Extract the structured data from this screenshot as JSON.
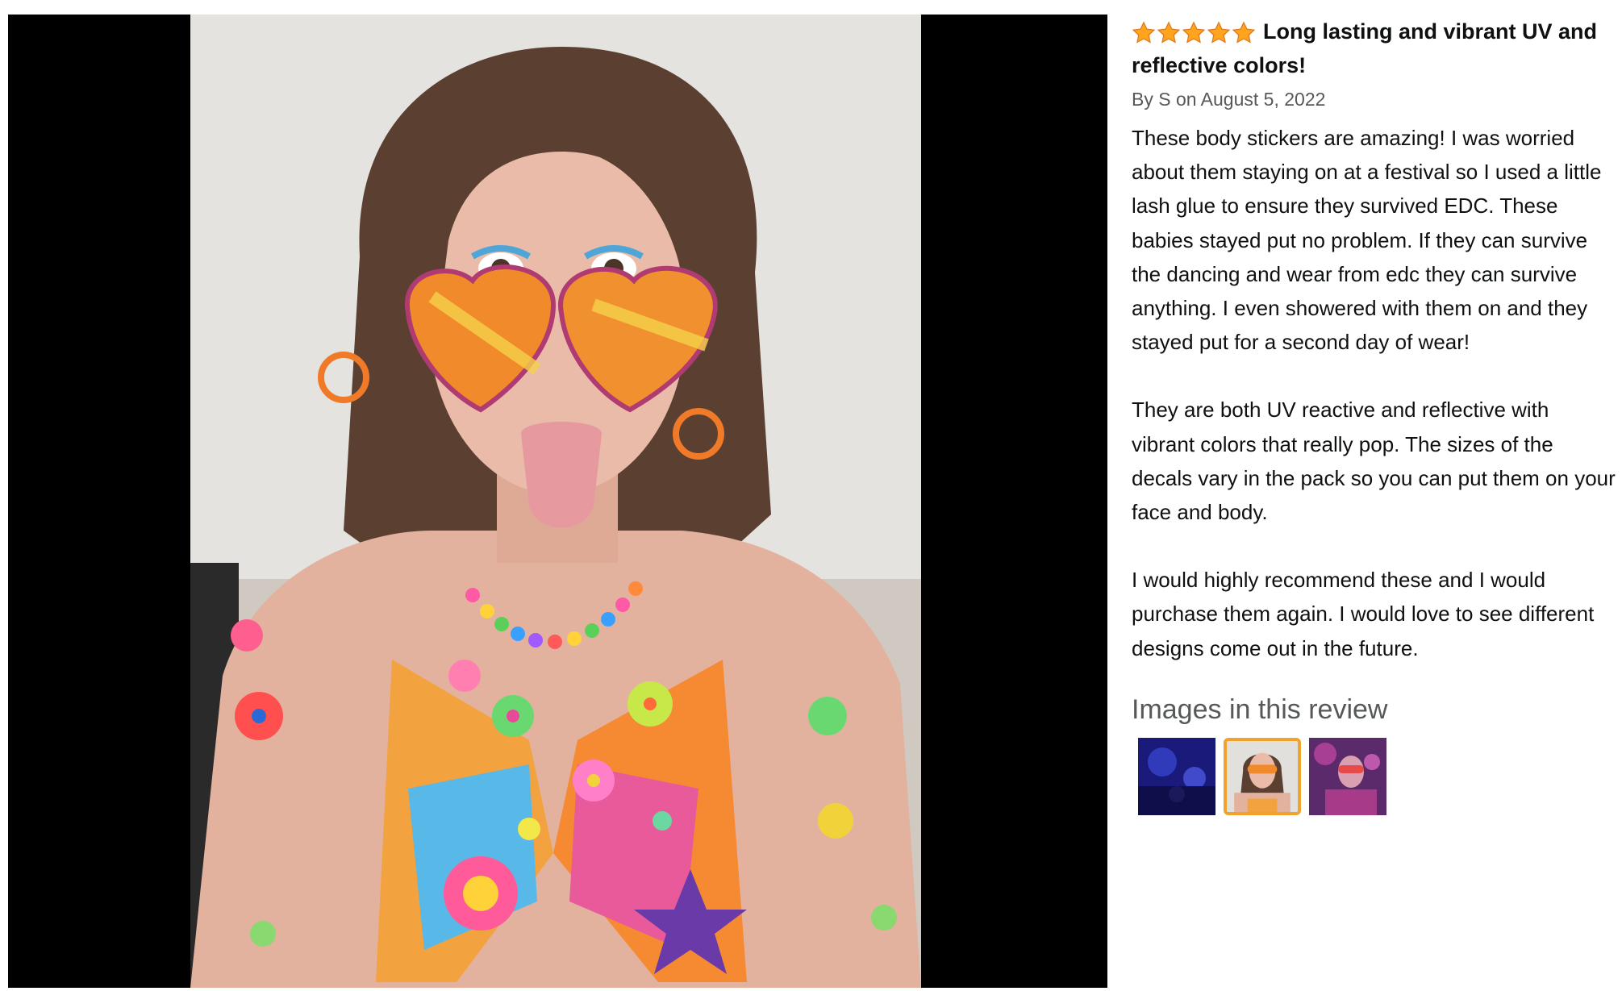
{
  "review": {
    "rating": 5,
    "title": "Long lasting and vibrant UV and reflective colors!",
    "byline": "By S on August 5, 2022",
    "paragraphs": [
      "These body stickers are amazing! I was worried about them staying on at a festival so I used a little lash glue to ensure they survived EDC. These babies stayed put no problem. If they can survive the dancing and wear from edc they can survive anything. I even showered with them on and they stayed put for a second day of wear!",
      "They are both UV reactive and reflective with vibrant colors that really pop. The sizes of the decals vary in the pack so you can put them on your face and body.",
      "I would highly recommend these and I would purchase them again. I would love to see different designs come out in the future."
    ],
    "images_heading": "Images in this review",
    "selected_thumbnail_index": 1
  },
  "colors": {
    "star": "#ffa41c",
    "star_stroke": "#de7921",
    "selected_border": "#f0a22d",
    "viewer_background": "#000000"
  }
}
